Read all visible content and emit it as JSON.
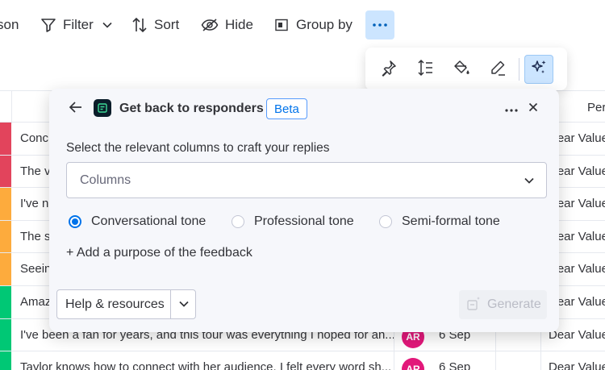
{
  "toolbar": {
    "person_label": "son",
    "filter_label": "Filter",
    "sort_label": "Sort",
    "hide_label": "Hide",
    "group_label": "Group by",
    "more_icon": "ellipsis-icon"
  },
  "floating_bar": {
    "icons": [
      "pin-icon",
      "row-height-icon",
      "paint-bucket-icon",
      "pen-icon",
      "sparkle-ai-icon"
    ]
  },
  "table": {
    "reply_column_header": "Per",
    "rows": [
      {
        "color": "#e2445c",
        "text": "Conc",
        "avatar": "",
        "date": "",
        "reply": "Dear Valued Cu"
      },
      {
        "color": "#e2445c",
        "text": "The v",
        "avatar": "",
        "date": "",
        "reply": "Dear Valued Cu"
      },
      {
        "color": "#fdab3d",
        "text": "I've n",
        "avatar": "",
        "date": "",
        "reply": "Dear Valued Cu"
      },
      {
        "color": "#fdab3d",
        "text": "The s",
        "avatar": "",
        "date": "",
        "reply": "Dear Valued Cu"
      },
      {
        "color": "#fdab3d",
        "text": "Seein",
        "avatar": "",
        "date": "",
        "reply": "Dear Valued Cu"
      },
      {
        "color": "#00c875",
        "text": "Amaz",
        "avatar": "",
        "date": "",
        "reply": "Dear Valued Cu"
      },
      {
        "color": "#00c875",
        "text": "I've been a fan for years, and this tour was everything I hoped for an...",
        "avatar": "AR",
        "date": "6 Sep",
        "reply": "Dear Valued Cu"
      },
      {
        "color": "#00c875",
        "text": "Taylor knows how to connect with her audience. I felt every word sh...",
        "avatar": "AR",
        "date": "6 Sep",
        "reply": "Dear Valued Cu"
      }
    ]
  },
  "dialog": {
    "title": "Get back to responders",
    "badge": "Beta",
    "columns_label": "Select the relevant columns to craft your replies",
    "columns_placeholder": "Columns",
    "tones": [
      {
        "label": "Conversational tone",
        "selected": true
      },
      {
        "label": "Professional tone",
        "selected": false
      },
      {
        "label": "Semi-formal tone",
        "selected": false
      }
    ],
    "add_purpose": "+ Add a purpose of the feedback",
    "help_label": "Help & resources",
    "generate_label": "Generate"
  },
  "colors": {
    "accent": "#0073ea",
    "accent_light": "#cce5ff",
    "avatar": "#e2187a"
  }
}
